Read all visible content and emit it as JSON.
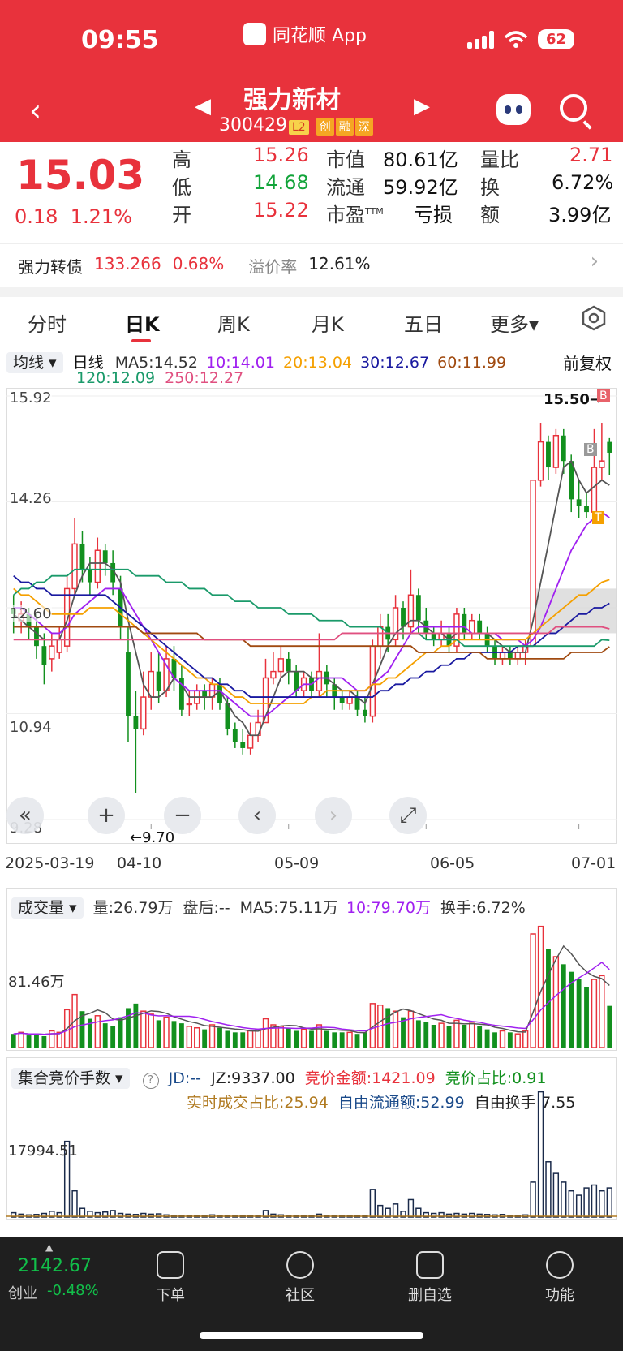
{
  "status": {
    "time": "09:55",
    "app": "同花顺 App",
    "battery": "62"
  },
  "header": {
    "title": "强力新材",
    "code": "300429",
    "tags": [
      "L2",
      "创",
      "融",
      "深"
    ]
  },
  "quote": {
    "price": "15.03",
    "change": "0.18",
    "change_pct": "1.21%",
    "high_label": "高",
    "high": "15.26",
    "low_label": "低",
    "low": "14.68",
    "open_label": "开",
    "open": "15.22",
    "mcap_label": "市值",
    "mcap": "80.61亿",
    "float_label": "流通",
    "float": "59.92亿",
    "pe_label": "市盈",
    "pe_sup": "TTM",
    "pe": "亏损",
    "vr_label": "量比",
    "vr": "2.71",
    "turn_label": "换",
    "turn": "6.72%",
    "amt_label": "额",
    "amt": "3.99亿"
  },
  "bond": {
    "name": "强力转债",
    "price": "133.266",
    "pct": "0.68%",
    "premium_label": "溢价率",
    "premium": "12.61%"
  },
  "tabs": [
    "分时",
    "日K",
    "周K",
    "月K",
    "五日",
    "更多▾"
  ],
  "ma_bar": {
    "selector": "均线 ▾",
    "period": "日线",
    "ma5": "MA5:14.52",
    "ma10": "10:14.01",
    "ma20": "20:13.04",
    "ma30": "30:12.67",
    "ma60": "60:11.99",
    "ma120": "120:12.09",
    "ma250": "250:12.27",
    "adjust": "前复权"
  },
  "chart_data": {
    "type": "candlestick",
    "y_ticks": [
      "15.92",
      "14.26",
      "12.60",
      "10.94",
      "9.28"
    ],
    "x_ticks": [
      "2025-03-19",
      "04-10",
      "05-09",
      "06-05",
      "07-01"
    ],
    "ylim": [
      9.28,
      15.92
    ],
    "annotations": {
      "max": "15.50→",
      "min": "←9.70",
      "b": "B",
      "t": "T"
    },
    "candles": [
      [
        12.6,
        12.5,
        12.8,
        12.2
      ],
      [
        12.4,
        12.5,
        12.7,
        12.2
      ],
      [
        12.5,
        12.3,
        12.6,
        12.1
      ],
      [
        12.3,
        12.0,
        12.5,
        11.8
      ],
      [
        12.0,
        11.7,
        12.2,
        11.4
      ],
      [
        11.8,
        12.0,
        12.2,
        11.6
      ],
      [
        11.9,
        12.1,
        12.3,
        11.8
      ],
      [
        12.0,
        12.9,
        13.1,
        11.9
      ],
      [
        12.9,
        13.6,
        14.0,
        12.8
      ],
      [
        13.6,
        13.2,
        13.8,
        13.0
      ],
      [
        13.2,
        13.0,
        13.4,
        12.8
      ],
      [
        13.0,
        13.5,
        13.7,
        12.9
      ],
      [
        13.5,
        13.3,
        13.6,
        13.1
      ],
      [
        13.3,
        13.0,
        13.5,
        12.8
      ],
      [
        12.9,
        12.3,
        13.1,
        12.1
      ],
      [
        11.9,
        10.9,
        12.3,
        10.5
      ],
      [
        10.9,
        10.7,
        11.3,
        9.7
      ],
      [
        10.7,
        11.2,
        11.6,
        10.6
      ],
      [
        11.2,
        11.6,
        11.9,
        11.0
      ],
      [
        11.6,
        11.3,
        11.9,
        11.1
      ],
      [
        11.3,
        11.8,
        12.0,
        11.2
      ],
      [
        11.8,
        11.5,
        12.0,
        11.3
      ],
      [
        11.5,
        11.0,
        11.7,
        10.9
      ],
      [
        11.1,
        11.1,
        11.3,
        10.9
      ],
      [
        11.1,
        11.3,
        11.4,
        11.0
      ],
      [
        11.3,
        11.2,
        11.4,
        11.0
      ],
      [
        11.2,
        11.4,
        11.5,
        11.0
      ],
      [
        11.4,
        11.1,
        11.5,
        11.0
      ],
      [
        11.1,
        10.7,
        11.2,
        10.6
      ],
      [
        10.7,
        10.5,
        10.8,
        10.4
      ],
      [
        10.5,
        10.4,
        10.7,
        10.3
      ],
      [
        10.4,
        10.6,
        10.8,
        10.3
      ],
      [
        10.6,
        10.8,
        11.0,
        10.5
      ],
      [
        10.8,
        11.5,
        11.8,
        10.8
      ],
      [
        11.5,
        11.6,
        11.9,
        11.4
      ],
      [
        11.6,
        11.8,
        12.0,
        11.5
      ],
      [
        11.8,
        11.6,
        11.9,
        11.4
      ],
      [
        11.6,
        11.3,
        11.7,
        11.2
      ],
      [
        11.3,
        11.5,
        11.6,
        11.2
      ],
      [
        11.5,
        11.3,
        11.6,
        11.2
      ],
      [
        11.3,
        11.6,
        12.2,
        11.2
      ],
      [
        11.6,
        11.4,
        11.7,
        11.2
      ],
      [
        11.4,
        11.2,
        11.5,
        11.0
      ],
      [
        11.2,
        11.1,
        11.3,
        11.0
      ],
      [
        11.1,
        11.2,
        11.3,
        11.0
      ],
      [
        11.2,
        11.0,
        11.3,
        10.9
      ],
      [
        11.0,
        10.9,
        11.2,
        10.8
      ],
      [
        10.9,
        12.0,
        12.1,
        10.8
      ],
      [
        12.0,
        12.3,
        12.5,
        11.8
      ],
      [
        12.3,
        12.1,
        12.5,
        11.9
      ],
      [
        12.1,
        12.6,
        12.8,
        12.0
      ],
      [
        12.6,
        12.3,
        12.7,
        12.1
      ],
      [
        12.3,
        12.8,
        13.2,
        12.2
      ],
      [
        12.8,
        12.4,
        12.9,
        12.2
      ],
      [
        12.4,
        12.2,
        12.6,
        12.1
      ],
      [
        12.2,
        12.1,
        12.3,
        12.0
      ],
      [
        12.1,
        12.2,
        12.4,
        12.0
      ],
      [
        12.2,
        12.0,
        12.3,
        11.9
      ],
      [
        12.0,
        12.5,
        12.6,
        11.9
      ],
      [
        12.5,
        12.2,
        12.6,
        12.1
      ],
      [
        12.2,
        12.4,
        12.5,
        12.1
      ],
      [
        12.4,
        12.2,
        12.5,
        12.1
      ],
      [
        12.2,
        12.0,
        12.3,
        11.9
      ],
      [
        12.0,
        11.8,
        12.1,
        11.7
      ],
      [
        11.8,
        11.9,
        12.0,
        11.7
      ],
      [
        11.9,
        11.8,
        12.0,
        11.7
      ],
      [
        11.8,
        11.9,
        12.0,
        11.7
      ],
      [
        11.9,
        12.0,
        12.1,
        11.7
      ],
      [
        12.0,
        14.6,
        14.6,
        12.0
      ],
      [
        14.6,
        15.2,
        15.5,
        14.5
      ],
      [
        15.2,
        14.8,
        15.3,
        14.6
      ],
      [
        14.8,
        15.3,
        15.4,
        14.7
      ],
      [
        15.3,
        14.9,
        15.4,
        14.7
      ],
      [
        14.9,
        14.3,
        15.0,
        14.1
      ],
      [
        14.3,
        14.2,
        14.6,
        14.0
      ],
      [
        14.2,
        14.1,
        14.4,
        14.0
      ],
      [
        14.1,
        14.8,
        15.4,
        14.0
      ],
      [
        14.8,
        14.9,
        15.5,
        14.6
      ],
      [
        15.2,
        15.03,
        15.26,
        14.68
      ]
    ],
    "series": [
      {
        "name": "MA5",
        "color": "#555555",
        "values": [
          12.5,
          12.4,
          12.3,
          12.2,
          12.1,
          12.1,
          12.1,
          12.4,
          12.8,
          13.1,
          13.3,
          13.3,
          13.3,
          13.2,
          13.0,
          12.4,
          11.9,
          11.4,
          11.2,
          11.2,
          11.3,
          11.5,
          11.4,
          11.2,
          11.2,
          11.2,
          11.2,
          11.3,
          11.1,
          10.9,
          10.8,
          10.6,
          10.6,
          10.9,
          11.2,
          11.5,
          11.6,
          11.6,
          11.6,
          11.5,
          11.5,
          11.5,
          11.4,
          11.3,
          11.3,
          11.2,
          11.1,
          11.4,
          11.7,
          12.0,
          12.2,
          12.3,
          12.4,
          12.4,
          12.3,
          12.2,
          12.2,
          12.1,
          12.2,
          12.2,
          12.2,
          12.2,
          12.2,
          12.1,
          12.0,
          11.9,
          11.9,
          11.9,
          12.4,
          13.0,
          13.6,
          14.2,
          14.8,
          14.9,
          14.6,
          14.4,
          14.5,
          14.6,
          14.52
        ]
      },
      {
        "name": "MA10",
        "color": "#a020f0",
        "values": [
          12.6,
          12.6,
          12.5,
          12.4,
          12.3,
          12.2,
          12.2,
          12.3,
          12.5,
          12.6,
          12.7,
          12.8,
          12.9,
          12.9,
          12.9,
          12.7,
          12.5,
          12.3,
          12.1,
          11.9,
          11.7,
          11.5,
          11.4,
          11.3,
          11.3,
          11.3,
          11.3,
          11.3,
          11.2,
          11.1,
          11.0,
          10.9,
          10.9,
          10.9,
          11.0,
          11.1,
          11.2,
          11.3,
          11.4,
          11.4,
          11.5,
          11.5,
          11.5,
          11.5,
          11.4,
          11.3,
          11.3,
          11.4,
          11.5,
          11.6,
          11.8,
          12.0,
          12.2,
          12.3,
          12.3,
          12.3,
          12.3,
          12.3,
          12.3,
          12.3,
          12.2,
          12.2,
          12.2,
          12.2,
          12.1,
          12.1,
          12.1,
          12.0,
          12.1,
          12.3,
          12.6,
          12.9,
          13.2,
          13.5,
          13.7,
          13.9,
          14.0,
          14.1,
          14.01
        ]
      },
      {
        "name": "MA20",
        "color": "#f5a000",
        "values": [
          12.9,
          12.8,
          12.8,
          12.7,
          12.6,
          12.5,
          12.5,
          12.5,
          12.5,
          12.5,
          12.6,
          12.6,
          12.6,
          12.6,
          12.5,
          12.4,
          12.3,
          12.2,
          12.1,
          12.0,
          11.9,
          11.8,
          11.7,
          11.6,
          11.5,
          11.5,
          11.4,
          11.4,
          11.3,
          11.2,
          11.2,
          11.1,
          11.1,
          11.1,
          11.1,
          11.1,
          11.1,
          11.1,
          11.1,
          11.2,
          11.2,
          11.3,
          11.3,
          11.3,
          11.3,
          11.3,
          11.3,
          11.4,
          11.4,
          11.5,
          11.5,
          11.6,
          11.7,
          11.8,
          11.9,
          11.9,
          12.0,
          12.0,
          12.1,
          12.1,
          12.1,
          12.1,
          12.1,
          12.1,
          12.1,
          12.1,
          12.1,
          12.1,
          12.2,
          12.3,
          12.4,
          12.5,
          12.6,
          12.7,
          12.8,
          12.8,
          12.9,
          13.0,
          13.04
        ]
      },
      {
        "name": "MA30",
        "color": "#1a1aa0",
        "values": [
          13.1,
          13.0,
          13.0,
          12.9,
          12.9,
          12.8,
          12.8,
          12.8,
          12.8,
          12.8,
          12.8,
          12.8,
          12.8,
          12.7,
          12.6,
          12.5,
          12.4,
          12.3,
          12.2,
          12.1,
          12.0,
          11.9,
          11.8,
          11.7,
          11.6,
          11.5,
          11.5,
          11.4,
          11.4,
          11.3,
          11.3,
          11.2,
          11.2,
          11.2,
          11.2,
          11.2,
          11.2,
          11.2,
          11.2,
          11.2,
          11.2,
          11.2,
          11.2,
          11.2,
          11.2,
          11.2,
          11.2,
          11.2,
          11.3,
          11.3,
          11.4,
          11.4,
          11.5,
          11.5,
          11.6,
          11.6,
          11.7,
          11.7,
          11.8,
          11.8,
          11.9,
          11.9,
          11.9,
          11.9,
          11.9,
          11.9,
          12.0,
          12.0,
          12.0,
          12.1,
          12.2,
          12.2,
          12.3,
          12.4,
          12.5,
          12.5,
          12.6,
          12.6,
          12.67
        ]
      },
      {
        "name": "MA60",
        "color": "#a04a10",
        "values": [
          12.3,
          12.3,
          12.3,
          12.3,
          12.3,
          12.3,
          12.3,
          12.3,
          12.3,
          12.3,
          12.3,
          12.3,
          12.3,
          12.3,
          12.3,
          12.3,
          12.3,
          12.2,
          12.2,
          12.2,
          12.2,
          12.2,
          12.2,
          12.2,
          12.2,
          12.1,
          12.1,
          12.1,
          12.1,
          12.1,
          12.1,
          12.0,
          12.0,
          12.0,
          12.0,
          12.0,
          12.0,
          12.0,
          12.0,
          12.0,
          12.0,
          12.0,
          12.0,
          12.0,
          12.0,
          12.0,
          12.0,
          12.0,
          12.0,
          12.0,
          12.0,
          12.0,
          12.0,
          11.9,
          11.9,
          11.9,
          11.9,
          11.9,
          11.9,
          11.9,
          11.9,
          11.9,
          11.8,
          11.8,
          11.8,
          11.8,
          11.8,
          11.8,
          11.8,
          11.8,
          11.8,
          11.8,
          11.8,
          11.9,
          11.9,
          11.9,
          11.9,
          11.9,
          11.99
        ]
      },
      {
        "name": "MA120",
        "color": "#1a9a6a",
        "values": [
          12.8,
          12.9,
          12.9,
          13.0,
          13.0,
          13.1,
          13.1,
          13.1,
          13.2,
          13.2,
          13.2,
          13.2,
          13.2,
          13.2,
          13.2,
          13.2,
          13.1,
          13.1,
          13.1,
          13.1,
          13.0,
          13.0,
          13.0,
          12.9,
          12.9,
          12.9,
          12.8,
          12.8,
          12.8,
          12.7,
          12.7,
          12.7,
          12.6,
          12.6,
          12.6,
          12.6,
          12.5,
          12.5,
          12.5,
          12.5,
          12.4,
          12.4,
          12.4,
          12.4,
          12.3,
          12.3,
          12.3,
          12.3,
          12.3,
          12.2,
          12.2,
          12.2,
          12.2,
          12.2,
          12.1,
          12.1,
          12.1,
          12.1,
          12.1,
          12.0,
          12.0,
          12.0,
          12.0,
          12.0,
          12.0,
          12.0,
          12.0,
          12.0,
          12.0,
          12.0,
          12.0,
          12.0,
          12.0,
          12.0,
          12.0,
          12.0,
          12.0,
          12.1,
          12.09
        ]
      },
      {
        "name": "MA250",
        "color": "#e05080",
        "values": [
          12.1,
          12.1,
          12.1,
          12.1,
          12.1,
          12.1,
          12.1,
          12.1,
          12.1,
          12.1,
          12.1,
          12.1,
          12.1,
          12.1,
          12.1,
          12.1,
          12.1,
          12.1,
          12.1,
          12.1,
          12.1,
          12.1,
          12.1,
          12.1,
          12.1,
          12.1,
          12.1,
          12.1,
          12.1,
          12.1,
          12.1,
          12.1,
          12.1,
          12.1,
          12.1,
          12.1,
          12.1,
          12.1,
          12.1,
          12.1,
          12.1,
          12.1,
          12.1,
          12.2,
          12.2,
          12.2,
          12.2,
          12.2,
          12.2,
          12.2,
          12.2,
          12.2,
          12.2,
          12.2,
          12.2,
          12.2,
          12.2,
          12.2,
          12.2,
          12.2,
          12.2,
          12.2,
          12.2,
          12.2,
          12.2,
          12.2,
          12.2,
          12.2,
          12.2,
          12.2,
          12.2,
          12.3,
          12.3,
          12.3,
          12.3,
          12.3,
          12.3,
          12.3,
          12.27
        ]
      }
    ],
    "volume": [
      18,
      20,
      16,
      18,
      15,
      22,
      20,
      50,
      70,
      48,
      38,
      42,
      32,
      28,
      40,
      52,
      58,
      48,
      44,
      36,
      40,
      35,
      32,
      28,
      26,
      24,
      30,
      26,
      22,
      20,
      20,
      22,
      24,
      38,
      30,
      28,
      26,
      22,
      24,
      22,
      30,
      22,
      20,
      20,
      20,
      18,
      20,
      58,
      56,
      52,
      48,
      40,
      48,
      36,
      34,
      30,
      32,
      28,
      36,
      30,
      32,
      28,
      24,
      20,
      22,
      20,
      18,
      22,
      150,
      160,
      130,
      120,
      110,
      100,
      90,
      80,
      90,
      95,
      55
    ],
    "volume_ylim": [
      0,
      165
    ],
    "auction": [
      30,
      20,
      15,
      18,
      25,
      40,
      30,
      520,
      180,
      60,
      40,
      30,
      35,
      45,
      25,
      20,
      18,
      25,
      20,
      22,
      15,
      12,
      10,
      8,
      12,
      10,
      15,
      12,
      10,
      8,
      8,
      10,
      12,
      45,
      20,
      15,
      12,
      10,
      12,
      10,
      20,
      12,
      10,
      8,
      10,
      8,
      10,
      190,
      80,
      60,
      90,
      40,
      120,
      60,
      30,
      25,
      30,
      20,
      25,
      20,
      25,
      20,
      18,
      15,
      18,
      12,
      10,
      15,
      240,
      860,
      380,
      300,
      240,
      180,
      150,
      200,
      220,
      180,
      200
    ],
    "auction_ylim": [
      0,
      880
    ]
  },
  "chart_controls": [
    "«",
    "+",
    "−",
    "‹",
    "›",
    "⤢"
  ],
  "volume_bar": {
    "selector": "成交量 ▾",
    "vol": "量:26.79万",
    "after": "盘后:--",
    "ma5": "MA5:75.11万",
    "ma10": "10:79.70万",
    "turnover": "换手:6.72%",
    "y_label": "81.46万"
  },
  "auction_bar": {
    "selector": "集合竞价手数 ▾",
    "help": "?",
    "jd": "JD:--",
    "jz": "JZ:9337.00",
    "amount": "竞价金额:1421.09",
    "ratio": "竞价占比:0.91",
    "realtime": "实时成交占比:25.94",
    "free_float": "自由流通额:52.99",
    "free_turn": "自由换手:7.55",
    "y_label": "17994.51"
  },
  "colors": {
    "up": "#e8323c",
    "down": "#12901e",
    "header_bg": "#e8323c"
  },
  "bottom": {
    "index_value": "2142.67",
    "index_name": "创业",
    "index_change": "-0.48%",
    "nav": [
      "下单",
      "社区",
      "删自选",
      "功能"
    ]
  }
}
